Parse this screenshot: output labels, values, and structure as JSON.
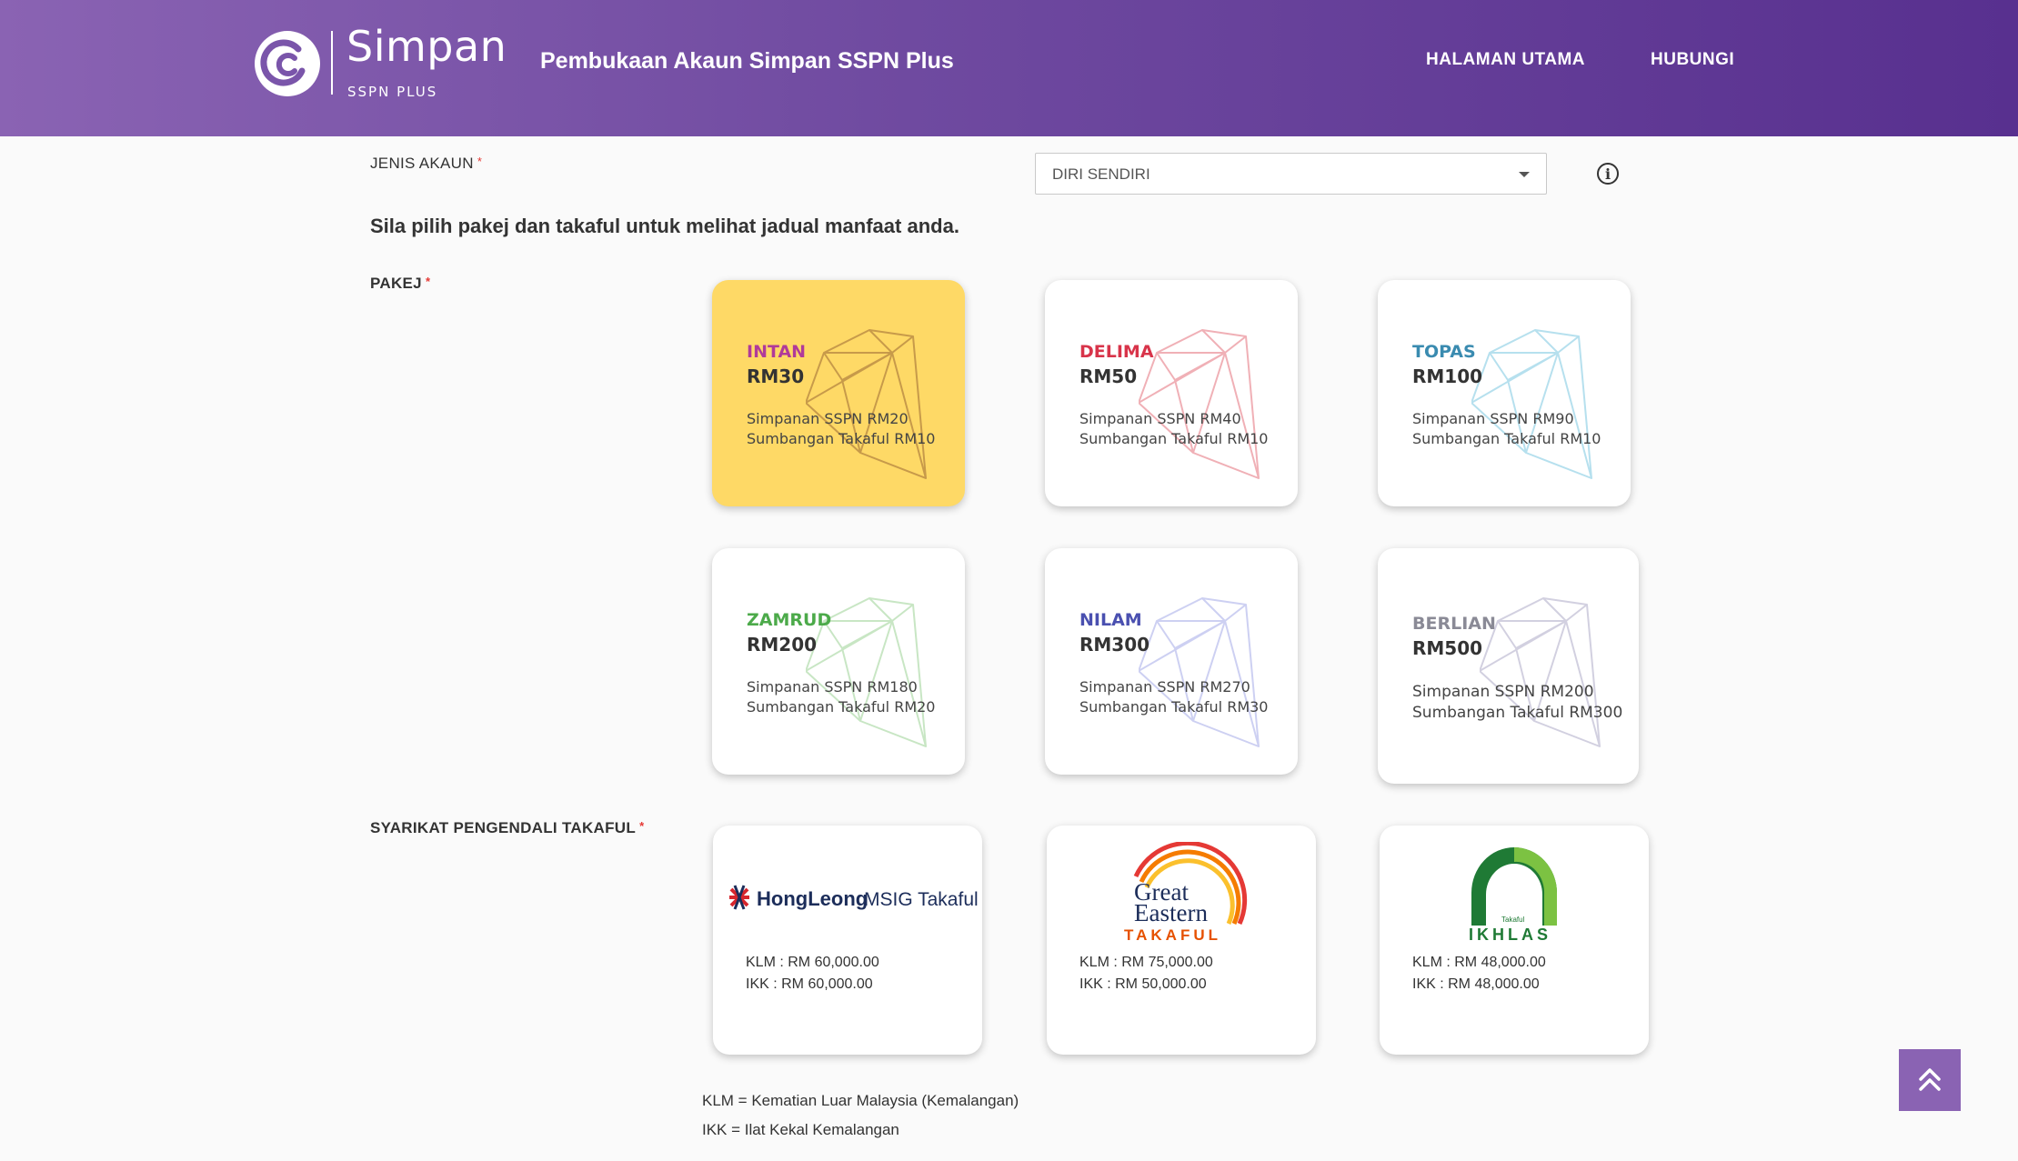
{
  "header": {
    "logo_name": "Simpan",
    "logo_sub": "SSPN PLUS",
    "title": "Pembukaan Akaun Simpan SSPN Plus",
    "nav": [
      {
        "label": "HALAMAN UTAMA"
      },
      {
        "label": "HUBUNGI"
      }
    ]
  },
  "form": {
    "account_type_label": "JENIS AKAUN",
    "account_type_value": "DIRI SENDIRI",
    "required_mark": "*",
    "instruction": "Sila pilih pakej dan takaful untuk melihat jadual manfaat anda.",
    "package_label": "PAKEJ",
    "takaful_label": "SYARIKAT PENGENDALI TAKAFUL"
  },
  "packages": [
    {
      "name": "INTAN",
      "price": "RM30",
      "savings": "Simpanan SSPN RM20",
      "takaful": "Sumbangan Takaful RM10",
      "color": "#b03a9a",
      "gem_color": "#c79a4a",
      "selected": true
    },
    {
      "name": "DELIMA",
      "price": "RM50",
      "savings": "Simpanan SSPN RM40",
      "takaful": "Sumbangan Takaful RM10",
      "color": "#d8344a",
      "gem_color": "#f0b0b6",
      "selected": false
    },
    {
      "name": "TOPAS",
      "price": "RM100",
      "savings": "Simpanan SSPN RM90",
      "takaful": "Sumbangan Takaful RM10",
      "color": "#3a8bb0",
      "gem_color": "#b6e0ee",
      "selected": false
    },
    {
      "name": "ZAMRUD",
      "price": "RM200",
      "savings": "Simpanan SSPN RM180",
      "takaful": "Sumbangan Takaful RM20",
      "color": "#4caa4a",
      "gem_color": "#c8e6c4",
      "selected": false
    },
    {
      "name": "NILAM",
      "price": "RM300",
      "savings": "Simpanan SSPN RM270",
      "takaful": "Sumbangan Takaful RM30",
      "color": "#4a50b0",
      "gem_color": "#cdd0f2",
      "selected": false
    },
    {
      "name": "BERLIAN",
      "price": "RM500",
      "savings": "Simpanan SSPN RM200",
      "takaful": "Sumbangan Takaful RM300",
      "color": "#8a8a96",
      "gem_color": "#d2d0e0",
      "selected": false
    }
  ],
  "takaful_companies": [
    {
      "logo_text": "HongLeong",
      "logo_text2": "MSIG Takaful",
      "klm": "KLM : RM 60,000.00",
      "ikk": "IKK : RM 60,000.00"
    },
    {
      "logo_text": "Great",
      "logo_text2": "Eastern",
      "logo_text3": "TAKAFUL",
      "klm": "KLM : RM 75,000.00",
      "ikk": "IKK : RM 50,000.00"
    },
    {
      "logo_text": "Takaful",
      "logo_text2": "IKHLAS",
      "klm": "KLM : RM 48,000.00",
      "ikk": "IKK : RM 48,000.00"
    }
  ],
  "legend": [
    "KLM = Kematian Luar Malaysia (Kemalangan)",
    "IKK = Ilat Kekal Kemalangan"
  ],
  "colors": {
    "header_start": "#8a63b3",
    "header_end": "#58308f",
    "selected_card": "#fed966",
    "required": "#e53935",
    "scroll_button": "#8a63b3"
  },
  "icons": {
    "info": "info-icon",
    "dropdown": "chevron-down-icon",
    "scroll_top": "double-chevron-up-icon",
    "gem": "gem-icon"
  }
}
